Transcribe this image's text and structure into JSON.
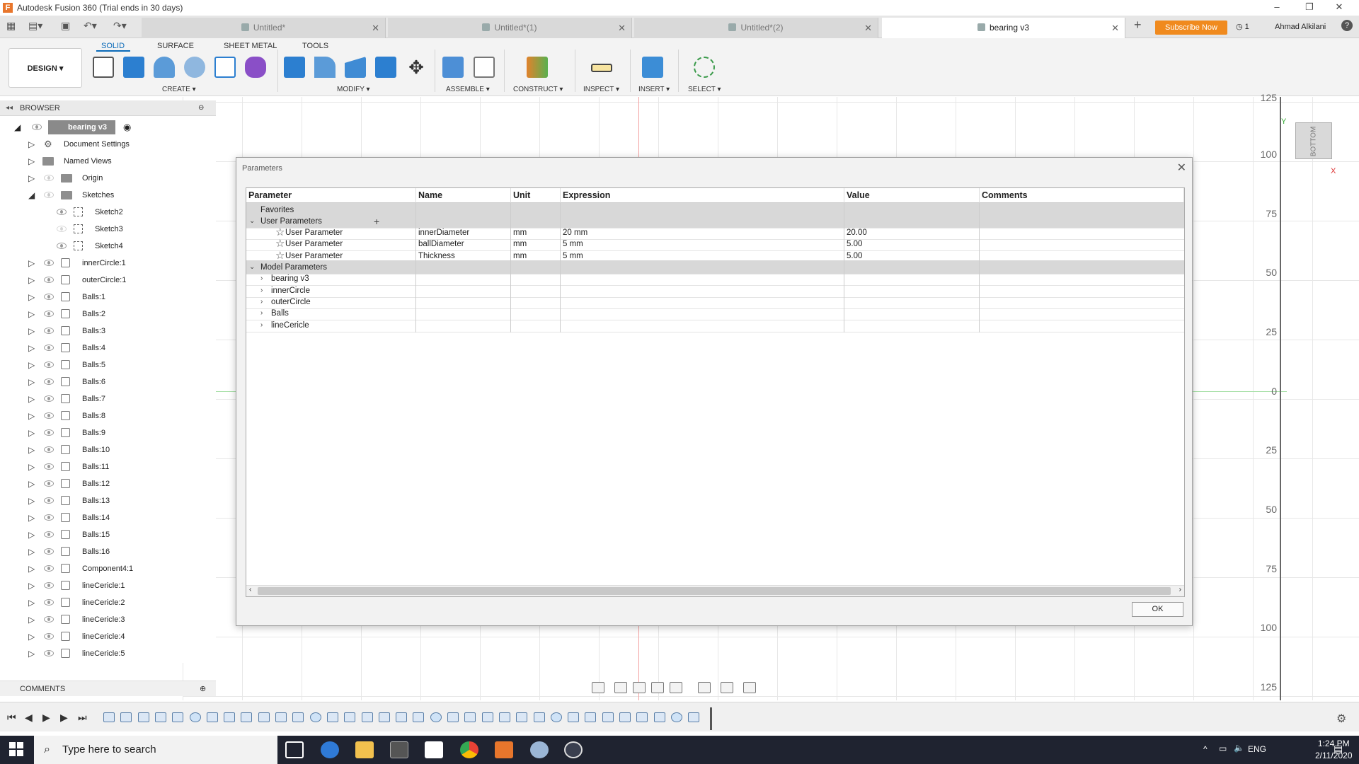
{
  "app": {
    "title": "Autodesk Fusion 360 (Trial ends in 30 days)",
    "user": "Ahmad Alkilani",
    "notifications": "1",
    "subscribe_label": "Subscribe Now"
  },
  "doc_tabs": [
    {
      "label": "Untitled*"
    },
    {
      "label": "Untitled*(1)"
    },
    {
      "label": "Untitled*(2)"
    },
    {
      "label": "bearing v3"
    }
  ],
  "ribbon": {
    "tabs": [
      "SOLID",
      "SURFACE",
      "SHEET METAL",
      "TOOLS"
    ],
    "workspace": "DESIGN ▾",
    "groups": [
      "CREATE ▾",
      "MODIFY ▾",
      "ASSEMBLE ▾",
      "CONSTRUCT ▾",
      "INSPECT ▾",
      "INSERT ▾",
      "SELECT ▾"
    ]
  },
  "browser": {
    "header": "BROWSER",
    "root": "bearing v3",
    "items": [
      "Document Settings",
      "Named Views",
      "Origin",
      "Sketches",
      "Sketch2",
      "Sketch3",
      "Sketch4",
      "innerCircle:1",
      "outerCircle:1",
      "Balls:1",
      "Balls:2",
      "Balls:3",
      "Balls:4",
      "Balls:5",
      "Balls:6",
      "Balls:7",
      "Balls:8",
      "Balls:9",
      "Balls:10",
      "Balls:11",
      "Balls:12",
      "Balls:13",
      "Balls:14",
      "Balls:15",
      "Balls:16",
      "Component4:1",
      "lineCericle:1",
      "lineCericle:2",
      "lineCericle:3",
      "lineCericle:4",
      "lineCericle:5"
    ],
    "footer": "COMMENTS"
  },
  "ruler": [
    "125",
    "100",
    "75",
    "50",
    "25",
    "0",
    "25",
    "50",
    "75",
    "100",
    "125"
  ],
  "viewcube_label": "BOTTOM",
  "axis": {
    "y": "Y",
    "x": "X"
  },
  "dialog": {
    "title": "Parameters",
    "columns": [
      "Parameter",
      "Name",
      "Unit",
      "Expression",
      "Value",
      "Comments"
    ],
    "favorites": "Favorites",
    "user_group": "User Parameters",
    "user_params": [
      {
        "param": "User Parameter",
        "name": "innerDiameter",
        "unit": "mm",
        "expr": "20 mm",
        "value": "20.00",
        "comment": ""
      },
      {
        "param": "User Parameter",
        "name": "ballDiameter",
        "unit": "mm",
        "expr": "5 mm",
        "value": "5.00",
        "comment": ""
      },
      {
        "param": "User Parameter",
        "name": "Thickness",
        "unit": "mm",
        "expr": "5 mm",
        "value": "5.00",
        "comment": ""
      }
    ],
    "model_group": "Model Parameters",
    "model_items": [
      "bearing v3",
      "innerCircle",
      "outerCircle",
      "Balls",
      "lineCericle"
    ],
    "ok_label": "OK"
  },
  "taskbar": {
    "search_placeholder": "Type here to search",
    "lang": "ENG",
    "time": "1:24 PM",
    "date": "2/11/2020"
  }
}
